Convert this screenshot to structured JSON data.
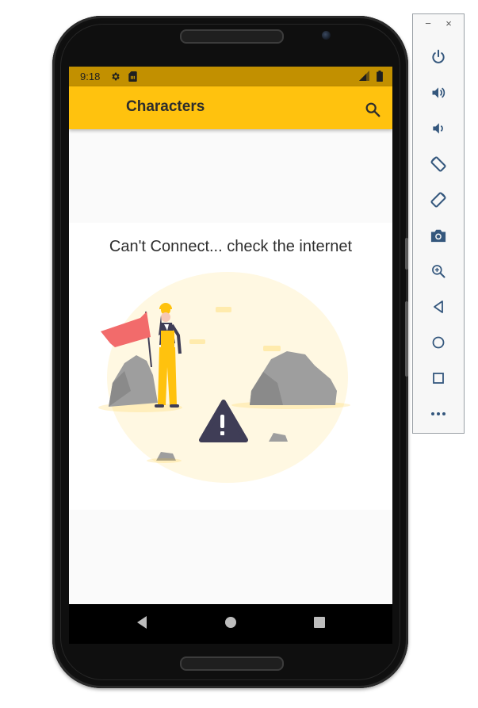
{
  "status_bar": {
    "time": "9:18",
    "left_icons": [
      "settings-icon",
      "sim-card-icon"
    ],
    "right_icons": [
      "signal-icon",
      "battery-icon"
    ]
  },
  "app_bar": {
    "title": "Characters",
    "search_icon": "search-icon"
  },
  "content": {
    "error_message": "Can't Connect... check the internet",
    "illustration": "worker-with-flag-and-warning-illustration"
  },
  "nav_bar": {
    "buttons": [
      "back-icon",
      "home-icon",
      "recents-icon"
    ]
  },
  "emulator_toolbar": {
    "window_buttons": {
      "minimize": "−",
      "close": "×"
    },
    "tools": [
      "power-icon",
      "volume-up-icon",
      "volume-down-icon",
      "rotate-left-icon",
      "rotate-right-icon",
      "camera-icon",
      "zoom-icon",
      "back-icon",
      "home-icon",
      "overview-icon",
      "more-icon"
    ]
  },
  "colors": {
    "status_bar": "#c29000",
    "app_bar": "#ffc20e",
    "background": "#fafafa",
    "illustration_yellow": "#ffc20e",
    "flag_red": "#f26b6b",
    "rock_gray": "#9e9e9e",
    "warning_dark": "#3f3d56",
    "toolbar_icon": "#34577d"
  }
}
